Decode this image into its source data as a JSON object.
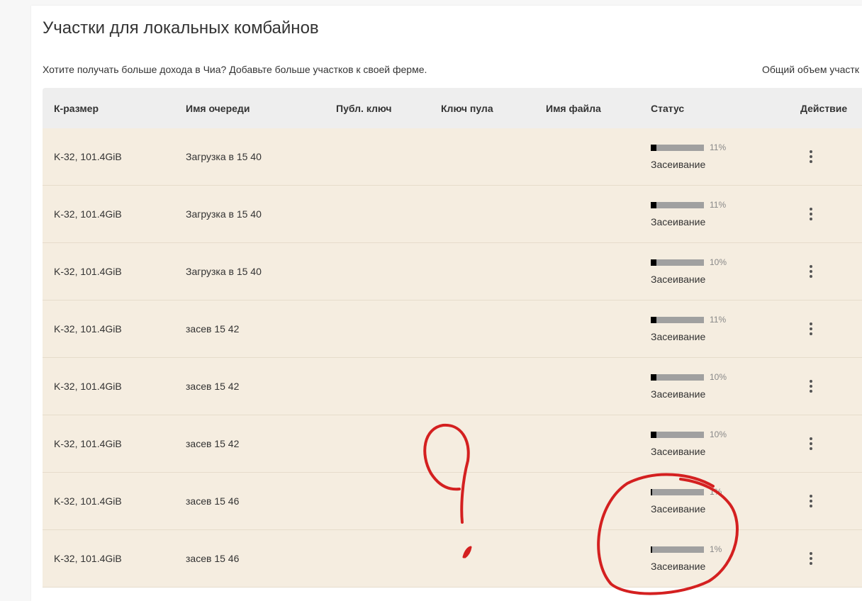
{
  "page": {
    "title": "Участки для локальных комбайнов",
    "subtitle": "Хотите получать больше дохода в Чиа? Добавьте больше участков к своей ферме.",
    "total_size_label": "Общий объем участк"
  },
  "table": {
    "headers": {
      "k_size": "К-размер",
      "queue_name": "Имя очереди",
      "pub_key": "Публ. ключ",
      "pool_key": "Ключ пула",
      "file_name": "Имя файла",
      "status": "Статус",
      "action": "Действие"
    },
    "rows": [
      {
        "k_size": "K-32, 101.4GiB",
        "queue": "Загрузка в 15 40",
        "progress": 11,
        "progress_label": "11%",
        "status": "Засеивание"
      },
      {
        "k_size": "K-32, 101.4GiB",
        "queue": "Загрузка в 15 40",
        "progress": 11,
        "progress_label": "11%",
        "status": "Засеивание"
      },
      {
        "k_size": "K-32, 101.4GiB",
        "queue": "Загрузка в 15 40",
        "progress": 10,
        "progress_label": "10%",
        "status": "Засеивание"
      },
      {
        "k_size": "K-32, 101.4GiB",
        "queue": "засев 15 42",
        "progress": 11,
        "progress_label": "11%",
        "status": "Засеивание"
      },
      {
        "k_size": "K-32, 101.4GiB",
        "queue": "засев 15 42",
        "progress": 10,
        "progress_label": "10%",
        "status": "Засеивание"
      },
      {
        "k_size": "K-32, 101.4GiB",
        "queue": "засев 15 42",
        "progress": 10,
        "progress_label": "10%",
        "status": "Засеивание"
      },
      {
        "k_size": "K-32, 101.4GiB",
        "queue": "засев 15 46",
        "progress": 1,
        "progress_label": "1%",
        "status": "Засеивание"
      },
      {
        "k_size": "K-32, 101.4GiB",
        "queue": "засев 15 46",
        "progress": 1,
        "progress_label": "1%",
        "status": "Засеивание"
      }
    ]
  },
  "icons": {
    "row_menu": "more-vert-icon"
  },
  "colors": {
    "row_background": "#f5ede0",
    "header_background": "#eeeeee",
    "progress_fill": "#000000",
    "progress_track": "#a0a0a0",
    "annotation_stroke": "#d42020"
  }
}
